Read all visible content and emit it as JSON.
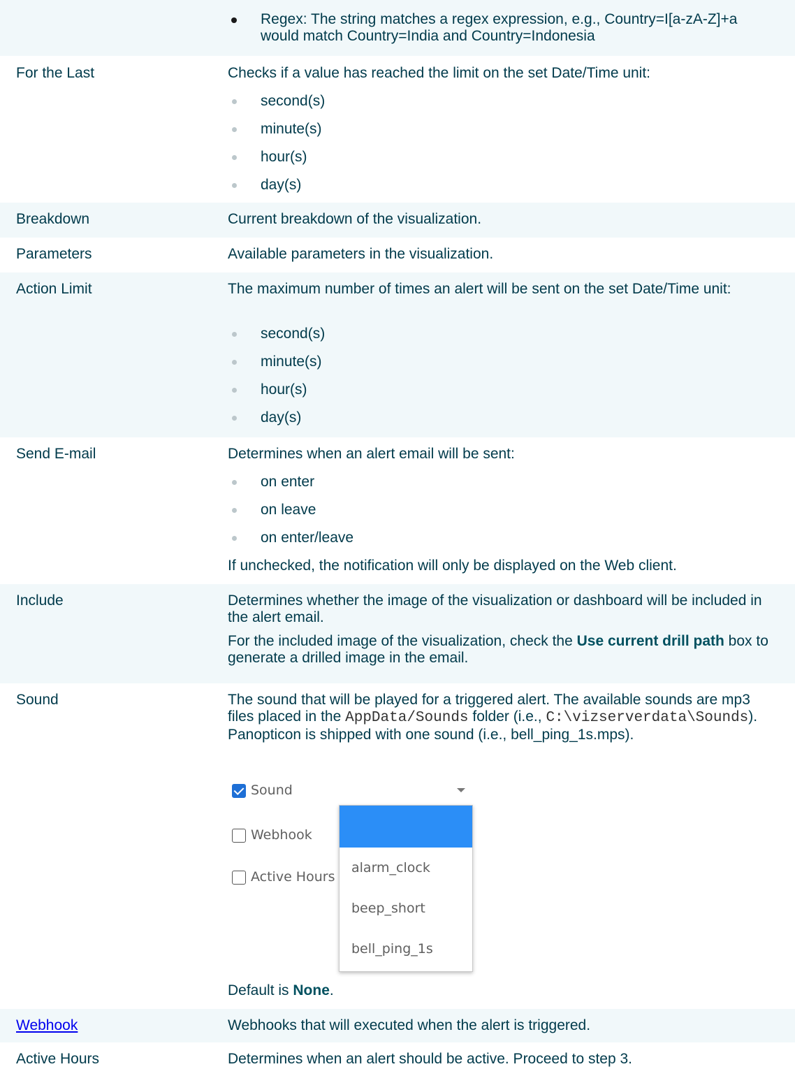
{
  "rows": [
    {
      "label": "",
      "desc_bullets_dark": [
        "Regex: The string matches a regex expression, e.g., Country=I[a-zA-Z]+a would match Country=India and Country=Indonesia"
      ]
    },
    {
      "label": "For the Last",
      "desc": "Checks if a value has reached the limit on the set Date/Time unit:",
      "bullets": [
        "second(s)",
        "minute(s)",
        "hour(s)",
        "day(s)"
      ]
    },
    {
      "label": "Breakdown",
      "desc": "Current breakdown of the visualization."
    },
    {
      "label": "Parameters",
      "desc": "Available parameters in the visualization."
    },
    {
      "label": "Action Limit",
      "desc": "The maximum number of times an alert will be sent on the set Date/Time unit:",
      "bullets": [
        "second(s)",
        "minute(s)",
        "hour(s)",
        "day(s)"
      ]
    },
    {
      "label": "Send E-mail",
      "desc": "Determines when an alert email will be sent:",
      "bullets": [
        "on enter",
        "on leave",
        "on enter/leave"
      ],
      "after": "If unchecked, the notification will only be displayed on the Web client."
    },
    {
      "label": "Include",
      "desc": "Determines whether the image of the visualization or dashboard will be included in the alert email.",
      "p2_pre": "For the included image of the visualization, check the ",
      "p2_bold": "Use current drill path",
      "p2_post": " box to generate a drilled image in the email."
    },
    {
      "label": "Sound",
      "p1_a": "The sound that will be played for a triggered alert. The available sounds are mp3 files placed in the ",
      "p1_code1": "AppData/Sounds",
      "p1_b": " folder (i.e., ",
      "p1_code2": "C:\\vizserverdata\\Sounds",
      "p1_c": "). Panopticon is shipped with one sound (i.e., bell_ping_1s.mps).",
      "default_pre": "Default is ",
      "default_bold": "None",
      "default_post": "."
    },
    {
      "label": "Webhook",
      "desc": "Webhooks that will executed when the alert is triggered."
    },
    {
      "label": "Active Hours",
      "desc": "Determines when an alert should be active. Proceed to step 3."
    }
  ],
  "shot": {
    "sound_label": "Sound",
    "webhook_label": "Webhook",
    "active_hours_label": "Active Hours",
    "options": [
      "alarm_clock",
      "beep_short",
      "bell_ping_1s"
    ],
    "selected_color": "#2b8ef7",
    "checkbox_color": "#1e6fd6"
  }
}
